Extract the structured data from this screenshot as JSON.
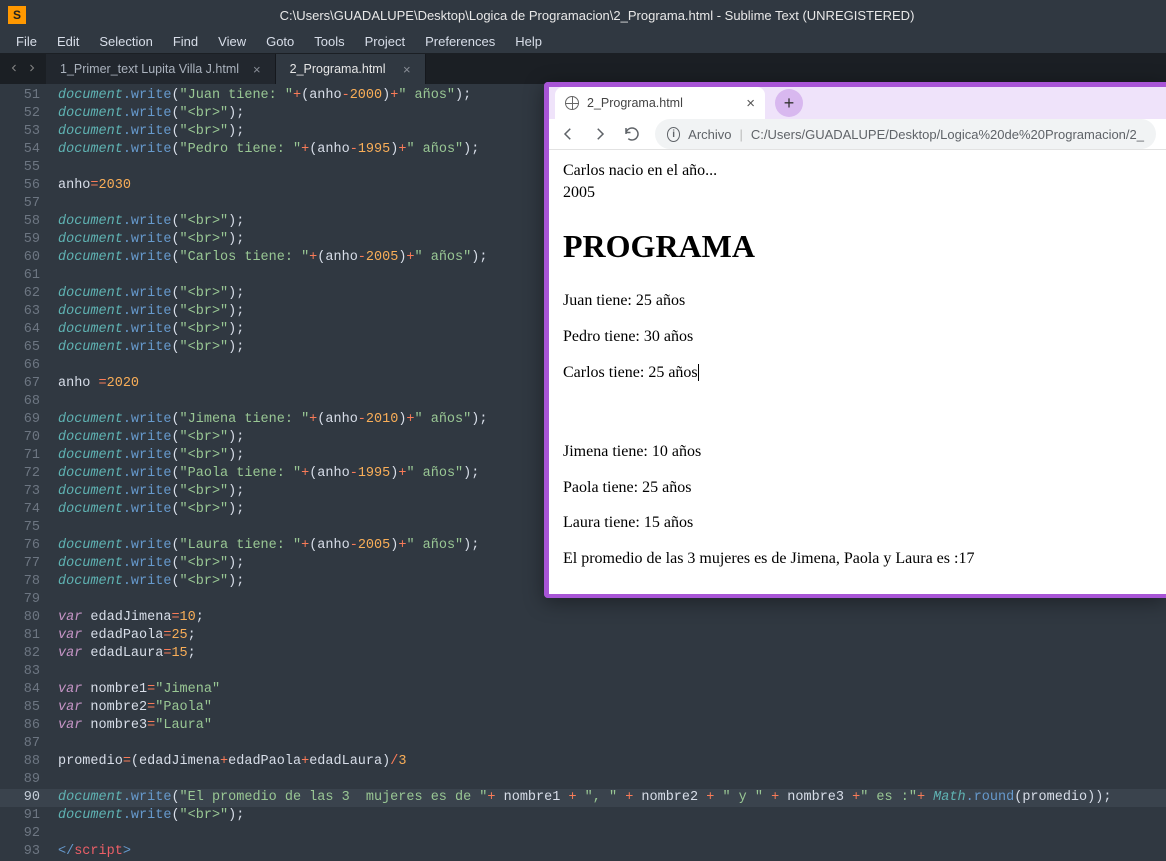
{
  "window": {
    "title": "C:\\Users\\GUADALUPE\\Desktop\\Logica de Programacion\\2_Programa.html - Sublime Text (UNREGISTERED)"
  },
  "menu": [
    "File",
    "Edit",
    "Selection",
    "Find",
    "View",
    "Goto",
    "Tools",
    "Project",
    "Preferences",
    "Help"
  ],
  "tabs": [
    {
      "label": "1_Primer_text Lupita Villa J.html",
      "active": false
    },
    {
      "label": "2_Programa.html",
      "active": true
    }
  ],
  "gutter": {
    "start": 51,
    "end": 93,
    "highlight": 90
  },
  "code_lines": {
    "l51": {
      "t": "dw_expr",
      "str1": "\"Juan tiene: \"",
      "var": "anho",
      "num": "2000",
      "str2": "\" años\""
    },
    "l52": {
      "t": "dw_str",
      "str": "\"<br>\";"
    },
    "l53": {
      "t": "dw_str",
      "str": "\"<br>\";"
    },
    "l54": {
      "t": "dw_expr",
      "str1": "\"Pedro tiene: \"",
      "var": "anho",
      "num": "1995",
      "str2": "\" años\""
    },
    "l55": {
      "t": "blank"
    },
    "l56": {
      "t": "assign",
      "lhs": "anho",
      "rhs": "2030"
    },
    "l57": {
      "t": "blank"
    },
    "l58": {
      "t": "dw_str",
      "str": "\"<br>\";"
    },
    "l59": {
      "t": "dw_str",
      "str": "\"<br>\";"
    },
    "l60": {
      "t": "dw_expr",
      "str1": "\"Carlos tiene: \"",
      "var": "anho",
      "num": "2005",
      "str2": "\" años\""
    },
    "l61": {
      "t": "blank"
    },
    "l62": {
      "t": "dw_str",
      "str": "\"<br>\";"
    },
    "l63": {
      "t": "dw_str",
      "str": "\"<br>\";"
    },
    "l64": {
      "t": "dw_str",
      "str": "\"<br>\";"
    },
    "l65": {
      "t": "dw_str",
      "str": "\"<br>\";"
    },
    "l66": {
      "t": "blank"
    },
    "l67": {
      "t": "assign_sp",
      "lhs": "anho ",
      "rhs": "2020"
    },
    "l68": {
      "t": "blank"
    },
    "l69": {
      "t": "dw_expr",
      "str1": "\"Jimena tiene: \"",
      "var": "anho",
      "num": "2010",
      "str2": "\" años\""
    },
    "l70": {
      "t": "dw_str",
      "str": "\"<br>\";"
    },
    "l71": {
      "t": "dw_str",
      "str": "\"<br>\";"
    },
    "l72": {
      "t": "dw_expr",
      "str1": "\"Paola tiene: \"",
      "var": "anho",
      "num": "1995",
      "str2": "\" años\""
    },
    "l73": {
      "t": "dw_str",
      "str": "\"<br>\";"
    },
    "l74": {
      "t": "dw_str",
      "str": "\"<br>\";"
    },
    "l75": {
      "t": "blank"
    },
    "l76": {
      "t": "dw_expr",
      "str1": "\"Laura tiene: \"",
      "var": "anho",
      "num": "2005",
      "str2": "\" años\""
    },
    "l77": {
      "t": "dw_str",
      "str": "\"<br>\";"
    },
    "l78": {
      "t": "dw_str",
      "str": "\"<br>\";"
    },
    "l79": {
      "t": "blank"
    },
    "l80": {
      "t": "var_num",
      "name": "edadJimena",
      "val": "10"
    },
    "l81": {
      "t": "var_num",
      "name": "edadPaola",
      "val": "25"
    },
    "l82": {
      "t": "var_num",
      "name": "edadLaura",
      "val": "15"
    },
    "l83": {
      "t": "blank"
    },
    "l84": {
      "t": "var_str",
      "name": "nombre1",
      "val": "\"Jimena\""
    },
    "l85": {
      "t": "var_str",
      "name": "nombre2",
      "val": "\"Paola\""
    },
    "l86": {
      "t": "var_str",
      "name": "nombre3",
      "val": "\"Laura\""
    },
    "l87": {
      "t": "blank"
    },
    "l88": {
      "t": "promedio",
      "a": "edadJimena",
      "b": "edadPaola",
      "c": "edadLaura",
      "d": "3"
    },
    "l89": {
      "t": "blank"
    },
    "l90": {
      "t": "final",
      "s0": "\"El promedio de las 3  mujeres es de \"",
      "n1": "nombre1",
      "s1": "\", \"",
      "n2": "nombre2",
      "s2": "\" y \"",
      "n3": "nombre3",
      "s3": "\" es :\"",
      "mfn": "round",
      "arg": "promedio"
    },
    "l91": {
      "t": "dw_str",
      "str": "\"<br>\";"
    },
    "l92": {
      "t": "blank"
    },
    "l93": {
      "t": "endscript"
    }
  },
  "browser": {
    "tab_title": "2_Programa.html",
    "url_label": "Archivo",
    "url_path": "C:/Users/GUADALUPE/Desktop/Logica%20de%20Programacion/2_",
    "content": {
      "line1": "Carlos nacio en el año...",
      "line2": "2005",
      "heading": "PROGRAMA",
      "p1": "Juan tiene: 25 años",
      "p2": "Pedro tiene: 30 años",
      "p3": "Carlos tiene: 25 años",
      "p4": "Jimena tiene: 10 años",
      "p5": "Paola tiene: 25 años",
      "p6": "Laura tiene: 15 años",
      "p7": "El promedio de las 3 mujeres es de Jimena, Paola y Laura es :17"
    }
  }
}
